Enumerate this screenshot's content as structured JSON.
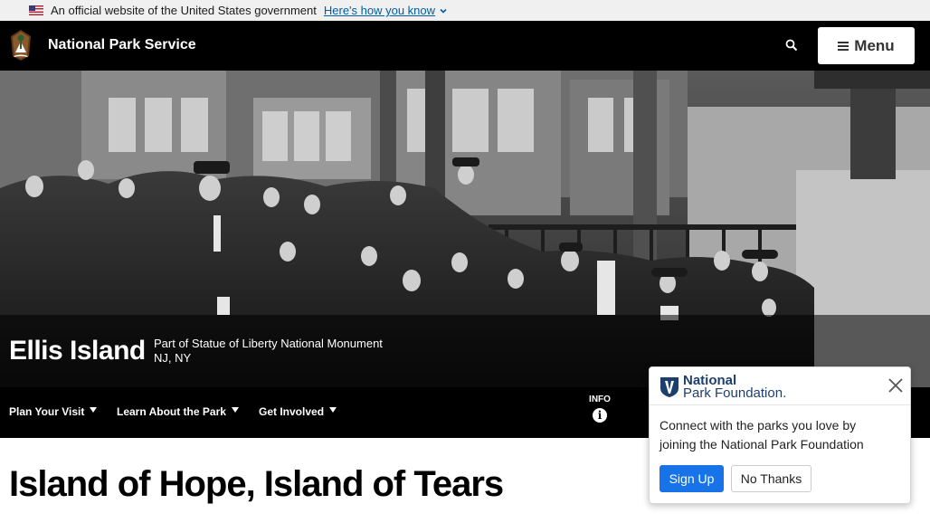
{
  "gov_banner": {
    "text": "An official website of the United States government",
    "link": "Here's how you know",
    "flag_icon": "us-flag-icon",
    "chevron_icon": "chevron-down-icon"
  },
  "header": {
    "site_name": "National Park Service",
    "logo_icon": "arrowhead-logo-icon",
    "search_icon": "search-icon",
    "menu_label": "Menu",
    "menu_icon": "hamburger-icon"
  },
  "hero": {
    "park_name": "Ellis Island",
    "subtitle_line1": "Part of Statue of Liberty National Monument",
    "subtitle_line2": "NJ, NY",
    "image": "black-and-white-photo-of-immigrants-at-ellis-island"
  },
  "park_nav": {
    "items": [
      {
        "label": "Plan Your Visit"
      },
      {
        "label": "Learn About the Park"
      },
      {
        "label": "Get Involved"
      }
    ],
    "info_label": "INFO",
    "info_icon": "info-icon"
  },
  "page": {
    "title": "Island of Hope, Island of Tears"
  },
  "npf_popup": {
    "logo_line1": "National",
    "logo_line2": "Park Foundation.",
    "message": "Connect with the parks you love by joining the National Park Foundation",
    "signup_label": "Sign Up",
    "no_thanks_label": "No Thanks",
    "close_icon": "close-icon"
  },
  "colors": {
    "header_bg": "#000000",
    "gov_banner_bg": "#f0f0f0",
    "link_blue": "#005ea2",
    "signup_blue": "#1873e8",
    "npf_navy": "#1d3f6e"
  }
}
